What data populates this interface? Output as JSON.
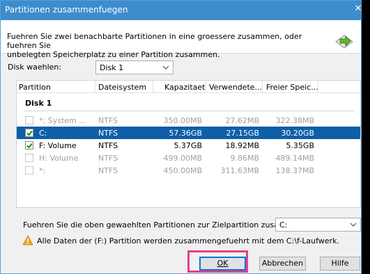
{
  "window": {
    "title": "Partitionen zusammenfuegen",
    "close_label": "✕",
    "description_line1": "Fuehren Sie zwei benachbarte Partitionen in eine groessere zusammen, oder fuehren Sie",
    "description_line2": "unbelegten Speicherplatz zu einer Partition zusammen."
  },
  "disk_select": {
    "label": "Disk waehlen:",
    "value": "Disk 1"
  },
  "table": {
    "columns": [
      "Partition",
      "Dateisystem",
      "Kapazitaet",
      "Verwendete...",
      "Freier Speic..."
    ],
    "group": "Disk 1",
    "rows": [
      {
        "checked": false,
        "name": "*: System ...",
        "fs": "NTFS",
        "capacity": "350.00MB",
        "used": "27.62MB",
        "free": "322.38MB",
        "state": "disabled"
      },
      {
        "checked": true,
        "name": "C:",
        "fs": "NTFS",
        "capacity": "57.36GB",
        "used": "27.15GB",
        "free": "30.20GB",
        "state": "selected"
      },
      {
        "checked": true,
        "name": "F: Volume",
        "fs": "NTFS",
        "capacity": "5.37GB",
        "used": "18.92MB",
        "free": "5.35GB",
        "state": "normal"
      },
      {
        "checked": false,
        "name": "H: Volume",
        "fs": "NTFS",
        "capacity": "499.00MB",
        "used": "9.86MB",
        "free": "489.14MB",
        "state": "disabled"
      },
      {
        "checked": false,
        "name": "*:",
        "fs": "NTFS",
        "capacity": "450.00MB",
        "used": "311.63MB",
        "free": "138.37MB",
        "state": "disabled"
      }
    ]
  },
  "target": {
    "label": "Fuehren Sie die oben gewaehlten Partitionen zur Zielpartition zusammen:",
    "value": "C:"
  },
  "warning": {
    "text": "Alle Daten der (F:) Partition werden zusammengefuehrt mit dem C:\\f-Laufwerk."
  },
  "buttons": {
    "ok": "OK",
    "cancel": "Abbrechen",
    "help": "Hilfe"
  }
}
